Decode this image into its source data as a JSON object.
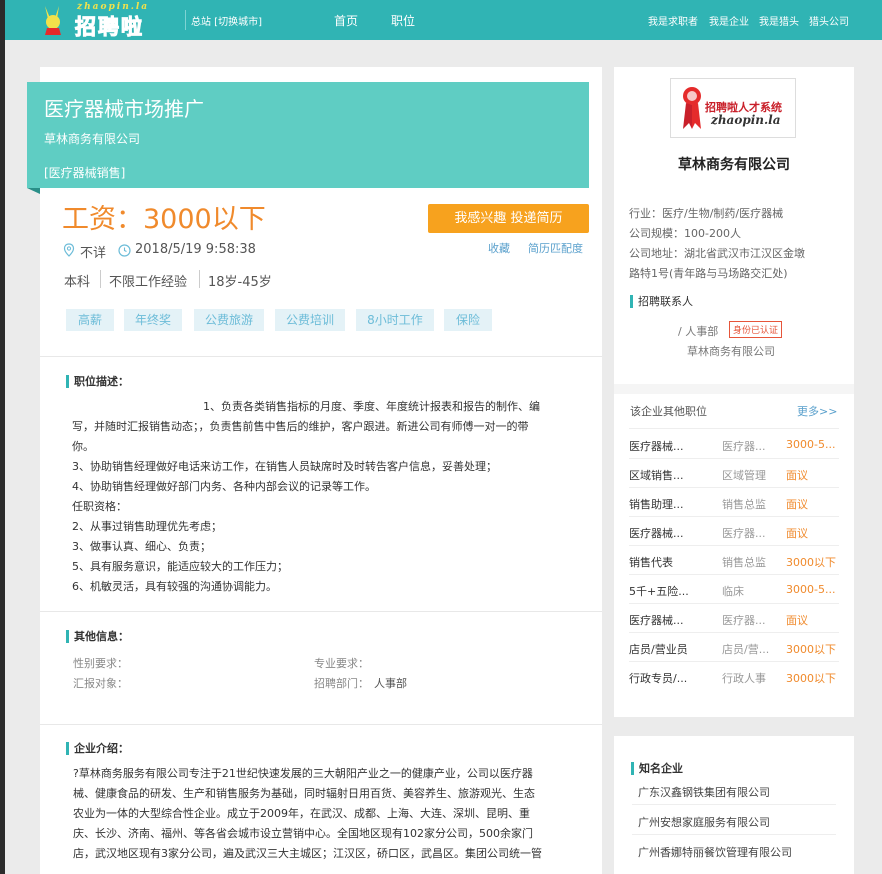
{
  "header": {
    "logo_en": "zhaopin.la",
    "logo_cn": "招聘啦",
    "city": "总站 [切换城市]",
    "nav": [
      "首页",
      "职位"
    ],
    "right_links": [
      "我是求职者",
      "我是企业",
      "我是猎头",
      "猎头公司"
    ]
  },
  "job": {
    "title": "医疗器械市场推广",
    "company": "草林商务有限公司",
    "category": "[医疗器械销售]",
    "salary": "工资：3000以下",
    "apply_label": "我感兴趣 投递简历",
    "location": "不详",
    "date": "2018/5/19 9:58:38",
    "favorite": "收藏",
    "match": "简历匹配度",
    "requirements": [
      "本科",
      "不限工作经验",
      "18岁-45岁"
    ],
    "tags": [
      "高薪",
      "年终奖",
      "公费旅游",
      "公费培训",
      "8小时工作",
      "保险"
    ]
  },
  "description": {
    "title": "职位描述：",
    "lines": [
      "1、负责各类销售指标的月度、季度、年度统计报表和报告的制作、编",
      "写，并随时汇报销售动态；，负责售前售中售后的维护，客户跟进。新进公司有师傅一对一的带",
      "你。",
      "3、协助销售经理做好电话来访工作，在销售人员缺席时及时转告客户信息，妥善处理；",
      "4、协助销售经理做好部门内务、各种内部会议的记录等工作。",
      "任职资格：",
      "2、从事过销售助理优先考虑；",
      "3、做事认真、细心、负责；",
      "5、具有服务意识，能适应较大的工作压力；",
      "6、机敏灵活，具有较强的沟通协调能力。"
    ]
  },
  "other_info": {
    "title": "其他信息：",
    "gender_label": "性别要求：",
    "major_label": "专业要求：",
    "report_label": "汇报对象：",
    "dept_label": "招聘部门：",
    "dept_value": "人事部"
  },
  "company_intro": {
    "title": "企业介绍：",
    "lines": [
      "?草林商务服务有限公司专注于21世纪快速发展的三大朝阳产业之一的健康产业，公司以医疗器",
      "械、健康食品的研发、生产和销售服务为基础，同时辐射日用百货、美容养生、旅游观光、生态",
      "农业为一体的大型综合性企业。成立于2009年，在武汉、成都、上海、大连、深圳、昆明、重",
      "庆、长沙、济南、福州、等各省会城市设立营销中心。全国地区现有102家分公司，500余家门",
      "店，武汉地区现有3家分公司，遍及武汉三大主城区；江汉区，硚口区，武昌区。集团公司统一管"
    ]
  },
  "sidebar": {
    "logo_text": "招聘啦人才系统",
    "logo_en": "zhaopin.la",
    "company": "草林商务有限公司",
    "industry": "行业：医疗/生物/制药/医疗器械",
    "size": "公司规模：100-200人",
    "address_1": "公司地址：湖北省武汉市江汉区金墩",
    "address_2": "路特1号(青年路与马场路交汇处)",
    "contact_title": "招聘联系人",
    "contact_dept": "/ 人事部",
    "verified": "身份已认证",
    "contact_company": "草林商务有限公司",
    "other_jobs_title": "该企业其他职位",
    "more": "更多>>",
    "other_jobs": [
      {
        "name": "医疗器械...",
        "cat": "医疗器...",
        "salary": "3000-5..."
      },
      {
        "name": "区域销售...",
        "cat": "区域管理",
        "salary": "面议"
      },
      {
        "name": "销售助理...",
        "cat": "销售总监",
        "salary": "面议"
      },
      {
        "name": "医疗器械...",
        "cat": "医疗器...",
        "salary": "面议"
      },
      {
        "name": "销售代表",
        "cat": "销售总监",
        "salary": "3000以下"
      },
      {
        "name": "5千+五险...",
        "cat": "临床",
        "salary": "3000-5..."
      },
      {
        "name": "医疗器械...",
        "cat": "医疗器...",
        "salary": "面议"
      },
      {
        "name": "店员/营业员",
        "cat": "店员/营...",
        "salary": "3000以下"
      },
      {
        "name": "行政专员/...",
        "cat": "行政人事",
        "salary": "3000以下"
      }
    ],
    "famous_title": "知名企业",
    "famous": [
      "广东汉鑫钢铁集团有限公司",
      "广州安想家庭服务有限公司",
      "广州香娜特丽餐饮管理有限公司"
    ]
  },
  "colors": {
    "header_teal": "#30b4b4",
    "title_box": "#5fcdc3",
    "salary_orange": "#f08a2c",
    "apply_button": "#f7a21e",
    "link_blue": "#5aa0cc"
  }
}
